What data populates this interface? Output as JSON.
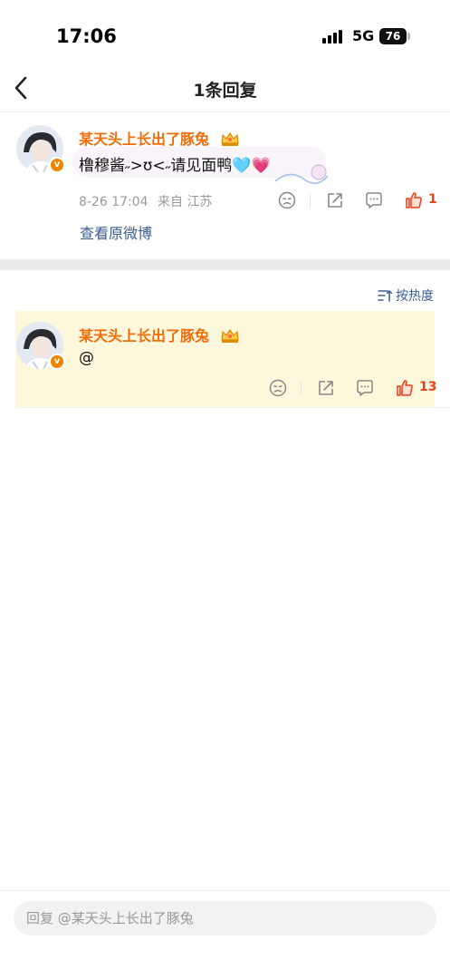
{
  "status_bar": {
    "time": "17:06",
    "network": "5G",
    "battery": "76"
  },
  "nav": {
    "title": "1条回复",
    "back_icon": "chevron-left-icon"
  },
  "original_comment": {
    "username": "某天头上长出了豚兔",
    "badge_icon": "crown-icon",
    "text": "橹穆酱˶>ʊ<˶请见面鸭🩵💗",
    "meta": {
      "date": "8-26 17:04",
      "source": "来自 江苏"
    },
    "like_count": "1",
    "view_original_label": "查看原微博"
  },
  "sort": {
    "label": "按热度"
  },
  "reply": {
    "username": "某天头上长出了豚兔",
    "badge_icon": "crown-icon",
    "text": "@",
    "like_count": "13"
  },
  "bottom": {
    "reply_placeholder": "回复 @某天头上长出了豚兔"
  },
  "colors": {
    "username": "#f26d0a",
    "like": "#e8401c",
    "link": "#3d5d94",
    "highlight_bg": "#fdf8dc"
  }
}
